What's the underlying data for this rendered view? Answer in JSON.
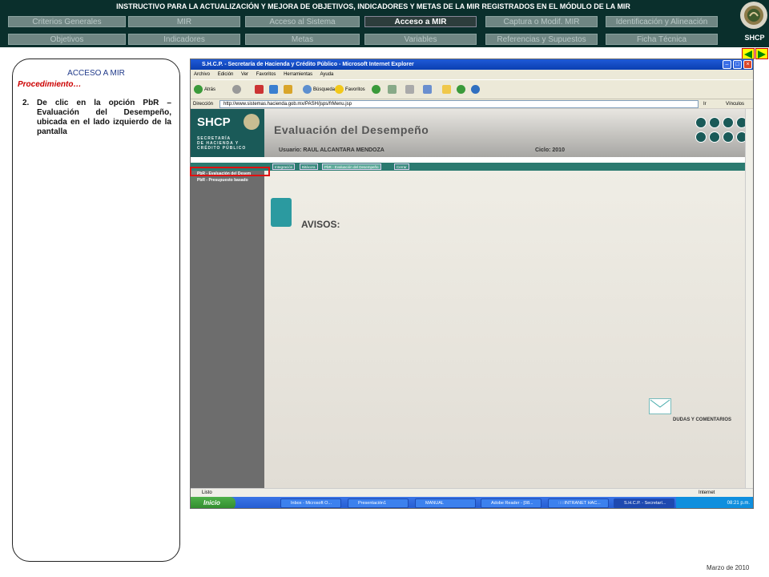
{
  "header": {
    "title": "INSTRUCTIVO PARA  LA ACTUALIZACIÓN Y MEJORA DE OBJETIVOS, INDICADORES Y METAS DE LA MIR REGISTRADOS EN EL MÓDULO DE LA MIR",
    "nav_row1": [
      "Criterios Generales",
      "MIR",
      "Acceso al Sistema",
      "Acceso a MIR",
      "Captura o Modif. MIR",
      "Identificación y Alineación"
    ],
    "nav_row2": [
      "Objetivos",
      "Indicadores",
      "Metas",
      "Variables",
      "Referencias y Supuestos",
      "Ficha Técnica"
    ],
    "active_tab": "Acceso a MIR",
    "logo_text": "SHCP"
  },
  "panel": {
    "title": "ACCESO A MIR",
    "subtitle": "Procedimiento…",
    "step_number": "2.",
    "step_text": "De clic en la opción  PbR – Evaluación del Desempeño, ubicada en el lado izquierdo de la pantalla"
  },
  "footer": {
    "date": "Marzo de 2010"
  },
  "screenshot": {
    "window_title": "S.H.C.P. - Secretaría de Hacienda y Crédito Público - Microsoft Internet Explorer",
    "menu": [
      "Archivo",
      "Edición",
      "Ver",
      "Favoritos",
      "Herramientas",
      "Ayuda"
    ],
    "toolbar": {
      "back": "Atrás",
      "search": "Búsqueda",
      "favorites": "Favoritos"
    },
    "address_label": "Dirección",
    "address": "http://www.sistemas.hacienda.gob.mx/PASH/jsps/frMenu.jsp",
    "go": "Ir",
    "links": "Vínculos",
    "banner": {
      "shcp": "SHCP",
      "secretaria": "SECRETARÍA\nDE HACIENDA Y\nCRÉDITO PÚBLICO",
      "heading": "Evaluación del Desempeño",
      "user": "Usuario: RAUL ALCANTARA MENDOZA",
      "ciclo": "Ciclo: 2010"
    },
    "subtabs": [
      "Integración",
      "Bitácora",
      "PbR - Evaluación del Desempeño",
      "Cerrar"
    ],
    "left_nav": [
      "PbR - Evaluación del Desem",
      "PbR - Presupuesto basado"
    ],
    "avisos": "AVISOS:",
    "dudas": "DUDAS Y COMENTARIOS",
    "status_left": "Listo",
    "status_right": "Internet",
    "start": "Inicio",
    "tasks": [
      "Inbox - Microsoft O...",
      "Presentación1",
      "MANUAL",
      "Adobe Reader - [08...",
      ":::::INTRANET HAC...",
      "S.H.C.P. - Secretarí..."
    ],
    "clock": "08:21 p.m."
  }
}
